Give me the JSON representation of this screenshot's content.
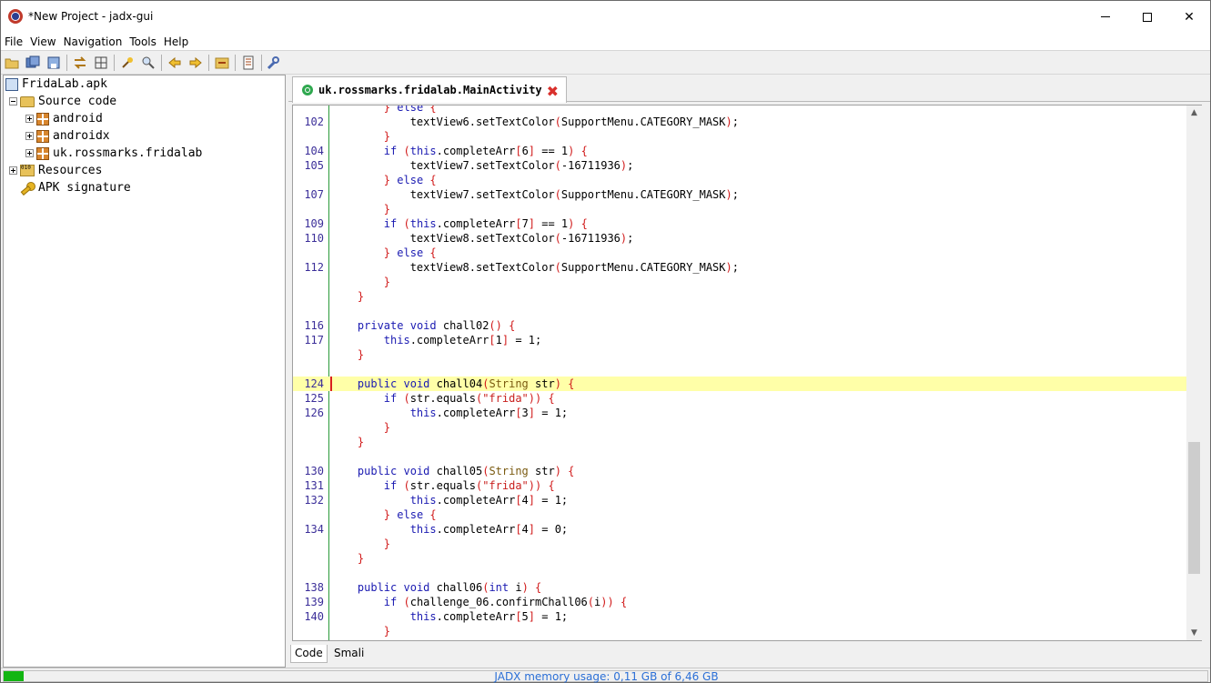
{
  "window": {
    "title": "*New Project - jadx-gui",
    "minimize_icon": "minimize-icon",
    "maximize_icon": "maximize-icon",
    "close_icon": "close-icon"
  },
  "menu": {
    "items": [
      "File",
      "View",
      "Navigation",
      "Tools",
      "Help"
    ]
  },
  "toolbar": {
    "icons": [
      "open-folder-icon",
      "save-all-icon",
      "export-icon",
      "sync-icon",
      "flatten-packages-icon",
      "search-text-icon",
      "search-class-icon",
      "back-icon",
      "forward-icon",
      "deobfuscation-icon",
      "log-icon",
      "preferences-icon"
    ]
  },
  "tree": {
    "root": "FridaLab.apk",
    "source_code": "Source code",
    "packages": [
      "android",
      "androidx",
      "uk.rossmarks.fridalab"
    ],
    "resources": "Resources",
    "apk_signature": "APK signature",
    "resources_icon_text": "010"
  },
  "editor": {
    "tab_title": "uk.rossmarks.fridalab.MainActivity",
    "tab_close": "✖",
    "scroll_up": "▲",
    "scroll_down": "▼",
    "highlight_line": "124",
    "lines": [
      {
        "ln": "",
        "src": "        } else {"
      },
      {
        "ln": "102",
        "src": "            textView6.setTextColor(SupportMenu.CATEGORY_MASK);"
      },
      {
        "ln": "",
        "src": "        }"
      },
      {
        "ln": "104",
        "src": "        if (this.completeArr[6] == 1) {"
      },
      {
        "ln": "105",
        "src": "            textView7.setTextColor(-16711936);"
      },
      {
        "ln": "",
        "src": "        } else {"
      },
      {
        "ln": "107",
        "src": "            textView7.setTextColor(SupportMenu.CATEGORY_MASK);"
      },
      {
        "ln": "",
        "src": "        }"
      },
      {
        "ln": "109",
        "src": "        if (this.completeArr[7] == 1) {"
      },
      {
        "ln": "110",
        "src": "            textView8.setTextColor(-16711936);"
      },
      {
        "ln": "",
        "src": "        } else {"
      },
      {
        "ln": "112",
        "src": "            textView8.setTextColor(SupportMenu.CATEGORY_MASK);"
      },
      {
        "ln": "",
        "src": "        }"
      },
      {
        "ln": "",
        "src": "    }"
      },
      {
        "ln": "",
        "src": ""
      },
      {
        "ln": "116",
        "src": "    private void chall02() {"
      },
      {
        "ln": "117",
        "src": "        this.completeArr[1] = 1;"
      },
      {
        "ln": "",
        "src": "    }"
      },
      {
        "ln": "",
        "src": ""
      },
      {
        "ln": "124",
        "src": "    public void chall04(String str) {"
      },
      {
        "ln": "125",
        "src": "        if (str.equals(\"frida\")) {"
      },
      {
        "ln": "126",
        "src": "            this.completeArr[3] = 1;"
      },
      {
        "ln": "",
        "src": "        }"
      },
      {
        "ln": "",
        "src": "    }"
      },
      {
        "ln": "",
        "src": ""
      },
      {
        "ln": "130",
        "src": "    public void chall05(String str) {"
      },
      {
        "ln": "131",
        "src": "        if (str.equals(\"frida\")) {"
      },
      {
        "ln": "132",
        "src": "            this.completeArr[4] = 1;"
      },
      {
        "ln": "",
        "src": "        } else {"
      },
      {
        "ln": "134",
        "src": "            this.completeArr[4] = 0;"
      },
      {
        "ln": "",
        "src": "        }"
      },
      {
        "ln": "",
        "src": "    }"
      },
      {
        "ln": "",
        "src": ""
      },
      {
        "ln": "138",
        "src": "    public void chall06(int i) {"
      },
      {
        "ln": "139",
        "src": "        if (challenge_06.confirmChall06(i)) {"
      },
      {
        "ln": "140",
        "src": "            this.completeArr[5] = 1;"
      },
      {
        "ln": "",
        "src": "        }"
      },
      {
        "ln": "",
        "src": "    }"
      }
    ]
  },
  "bottom_tabs": [
    "Code",
    "Smali"
  ],
  "status": {
    "memory_text": "JADX memory usage: 0,11 GB of 6,46 GB",
    "memory_fraction": 0.017
  },
  "colors": {
    "keyword": "#1b1bb2",
    "bracket": "#d11a1a",
    "highlight": "#ffffa8",
    "line_number": "#3b2e99",
    "memory_bar": "#12b512",
    "status_text": "#2b6fd6"
  }
}
